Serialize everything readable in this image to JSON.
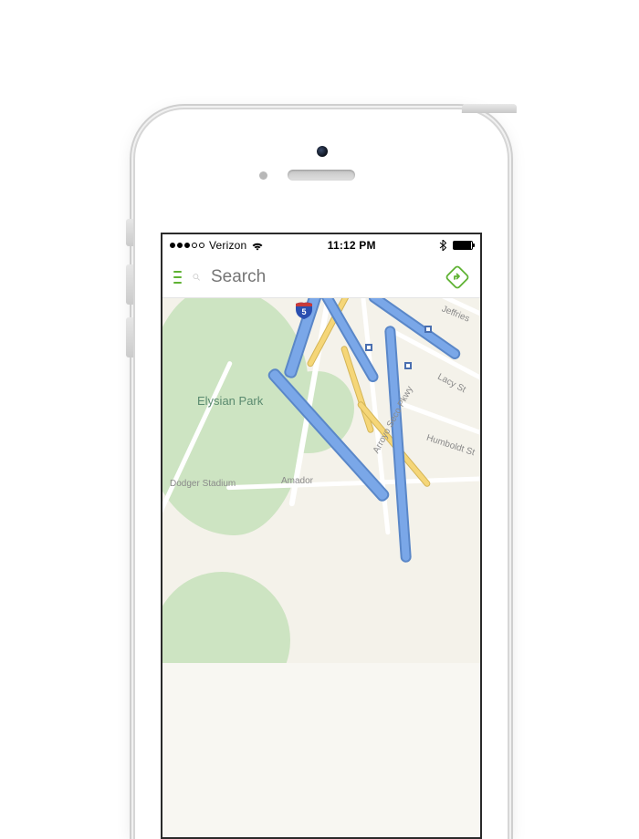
{
  "status_bar": {
    "carrier": "Verizon",
    "time": "11:12 PM",
    "signal_filled": 3,
    "signal_total": 5
  },
  "header": {
    "search_placeholder": "Search"
  },
  "map": {
    "park_label": "Elysian Park",
    "interstate_shield": "5",
    "roads": {
      "jeffries": "Jeffries",
      "lacy": "Lacy St",
      "humboldt": "Humboldt St",
      "arroyo": "Arroyo Seco Pkwy",
      "amador": "Amador",
      "dodger": "Dodger Stadium"
    }
  },
  "colors": {
    "accent": "#5fb233",
    "highway": "#7aa7e8",
    "park": "#cde4c2"
  }
}
